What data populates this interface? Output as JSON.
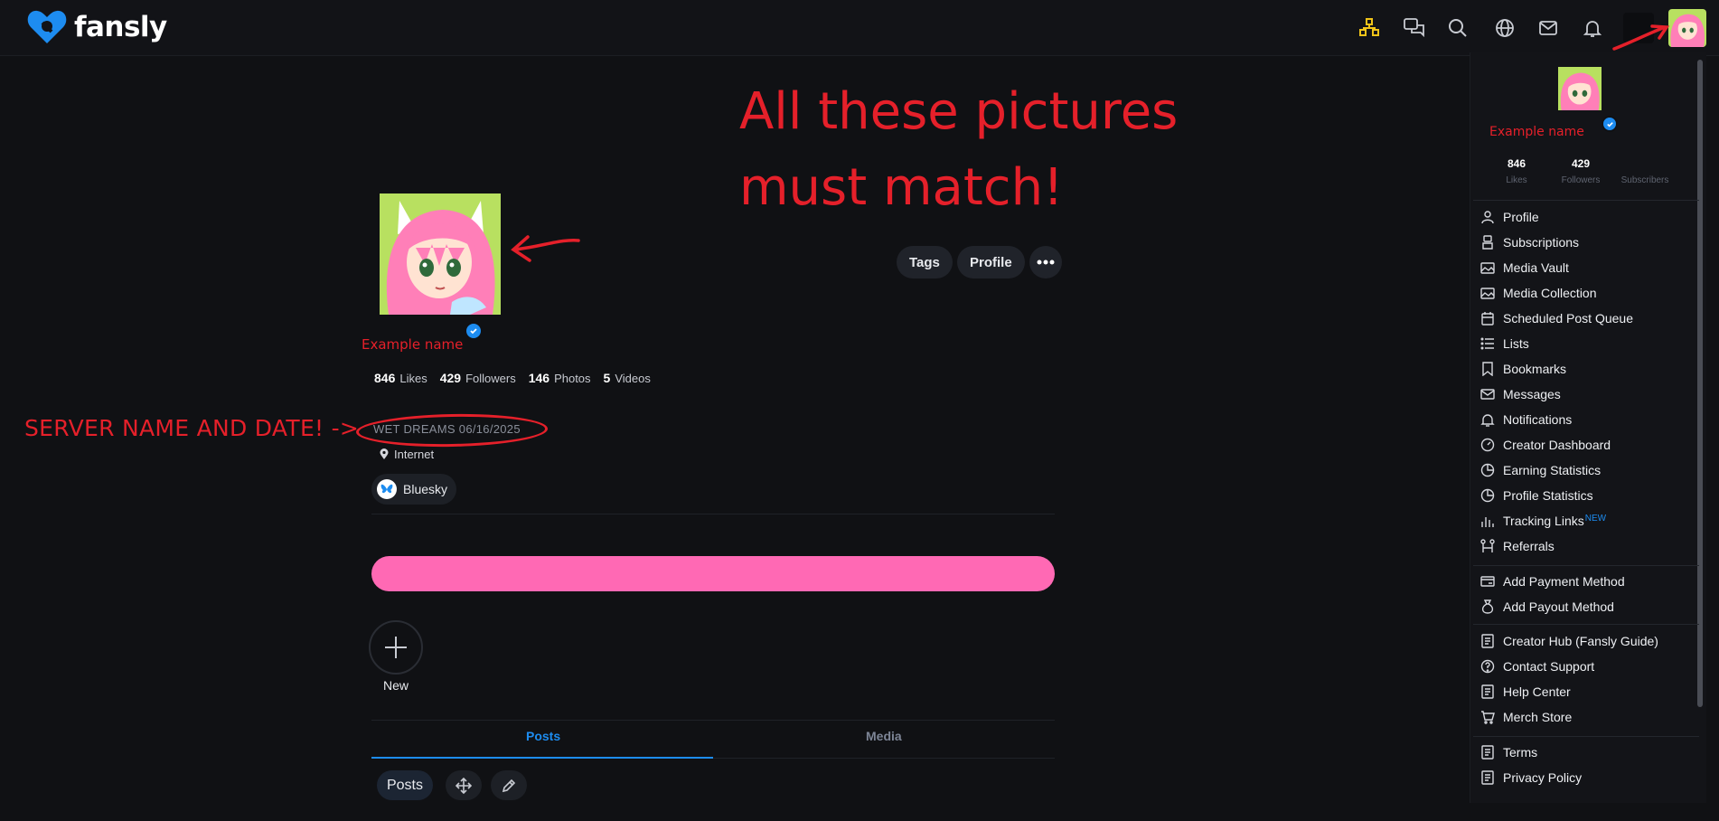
{
  "app": {
    "name": "fansly"
  },
  "colors": {
    "accent": "#1d8cf0",
    "annotation": "#e5202a",
    "pink": "#ff69b4",
    "background": "#101114"
  },
  "header": {
    "icons": [
      "creator-tiers-icon",
      "chat-icon",
      "search-icon",
      "globe-icon",
      "mail-icon",
      "bell-icon",
      "avatar"
    ]
  },
  "annotations": {
    "pictures_match_line1": "All these pictures",
    "pictures_match_line2": "must match!",
    "server_label": "SERVER NAME AND DATE! ->"
  },
  "profile": {
    "name": "Example name",
    "stats": [
      {
        "value": "846",
        "label": "Likes"
      },
      {
        "value": "429",
        "label": "Followers"
      },
      {
        "value": "146",
        "label": "Photos"
      },
      {
        "value": "5",
        "label": "Videos"
      }
    ],
    "server_date": "WET DREAMS 06/16/2025",
    "location": "Internet",
    "link": "Bluesky",
    "actions": {
      "tags": "Tags",
      "profile": "Profile"
    }
  },
  "stories": {
    "new_label": "New"
  },
  "tabs": [
    {
      "label": "Posts"
    },
    {
      "label": "Media"
    }
  ],
  "posts_toolbar": {
    "posts_label": "Posts"
  },
  "menu": {
    "name": "Example name",
    "stats": [
      {
        "value": "846",
        "label": "Likes"
      },
      {
        "value": "429",
        "label": "Followers"
      },
      {
        "value": "",
        "label": "Subscribers"
      }
    ],
    "items": [
      {
        "label": "Profile",
        "icon": "user-icon"
      },
      {
        "label": "Subscriptions",
        "icon": "subscriptions-icon"
      },
      {
        "label": "Media Vault",
        "icon": "image-icon"
      },
      {
        "label": "Media Collection",
        "icon": "image-icon"
      },
      {
        "label": "Scheduled Post Queue",
        "icon": "calendar-icon"
      },
      {
        "label": "Lists",
        "icon": "list-icon"
      },
      {
        "label": "Bookmarks",
        "icon": "bookmark-icon"
      },
      {
        "label": "Messages",
        "icon": "mail-icon"
      },
      {
        "label": "Notifications",
        "icon": "bell-icon"
      },
      {
        "label": "Creator Dashboard",
        "icon": "dashboard-icon"
      },
      {
        "label": "Earning Statistics",
        "icon": "pie-chart-icon"
      },
      {
        "label": "Profile Statistics",
        "icon": "pie-chart-icon"
      },
      {
        "label": "Tracking Links",
        "icon": "bar-chart-icon",
        "badge": "NEW"
      },
      {
        "label": "Referrals",
        "icon": "referrals-icon"
      }
    ],
    "payment_items": [
      {
        "label": "Add Payment Method",
        "icon": "card-icon"
      },
      {
        "label": "Add Payout Method",
        "icon": "money-bag-icon"
      }
    ],
    "help_items": [
      {
        "label": "Creator Hub (Fansly Guide)",
        "icon": "document-icon"
      },
      {
        "label": "Contact Support",
        "icon": "question-icon"
      },
      {
        "label": "Help Center",
        "icon": "document-icon"
      },
      {
        "label": "Merch Store",
        "icon": "cart-icon"
      }
    ],
    "legal_items": [
      {
        "label": "Terms",
        "icon": "document-icon"
      },
      {
        "label": "Privacy Policy",
        "icon": "document-icon"
      }
    ]
  }
}
